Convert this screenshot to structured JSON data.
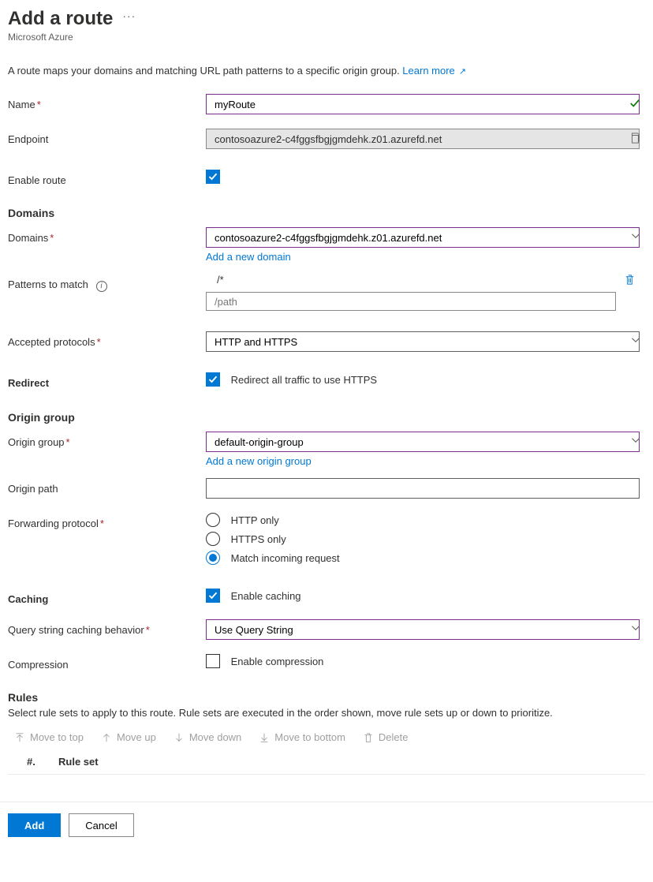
{
  "header": {
    "title": "Add a route",
    "subtitle": "Microsoft Azure"
  },
  "intro": {
    "text": "A route maps your domains and matching URL path patterns to a specific origin group. ",
    "link": "Learn more"
  },
  "fields": {
    "name_label": "Name",
    "name_value": "myRoute",
    "endpoint_label": "Endpoint",
    "endpoint_value": "contosoazure2-c4fggsfbgjgmdehk.z01.azurefd.net",
    "enable_route_label": "Enable route",
    "domains_section": "Domains",
    "domains_label": "Domains",
    "domains_value": "contosoazure2-c4fggsfbgjgmdehk.z01.azurefd.net",
    "add_domain_link": "Add a new domain",
    "patterns_label": "Patterns to match",
    "pattern_value": "/*",
    "pattern_placeholder": "/path",
    "accepted_protocols_label": "Accepted protocols",
    "accepted_protocols_value": "HTTP and HTTPS",
    "redirect_section": "Redirect",
    "redirect_label": "Redirect all traffic to use HTTPS",
    "origin_section": "Origin group",
    "origin_group_label": "Origin group",
    "origin_group_value": "default-origin-group",
    "add_origin_link": "Add a new origin group",
    "origin_path_label": "Origin path",
    "origin_path_value": "",
    "forwarding_label": "Forwarding protocol",
    "fwd_http": "HTTP only",
    "fwd_https": "HTTPS only",
    "fwd_match": "Match incoming request",
    "caching_section": "Caching",
    "caching_label": "Enable caching",
    "query_label": "Query string caching behavior",
    "query_value": "Use Query String",
    "compression_label": "Compression",
    "compression_cb": "Enable compression",
    "rules_section": "Rules",
    "rules_desc": "Select rule sets to apply to this route. Rule sets are executed in the order shown, move rule sets up or down to prioritize.",
    "toolbar": {
      "top": "Move to top",
      "up": "Move up",
      "down": "Move down",
      "bottom": "Move to bottom",
      "delete": "Delete"
    },
    "col_num": "#.",
    "col_ruleset": "Rule set"
  },
  "footer": {
    "add": "Add",
    "cancel": "Cancel"
  }
}
